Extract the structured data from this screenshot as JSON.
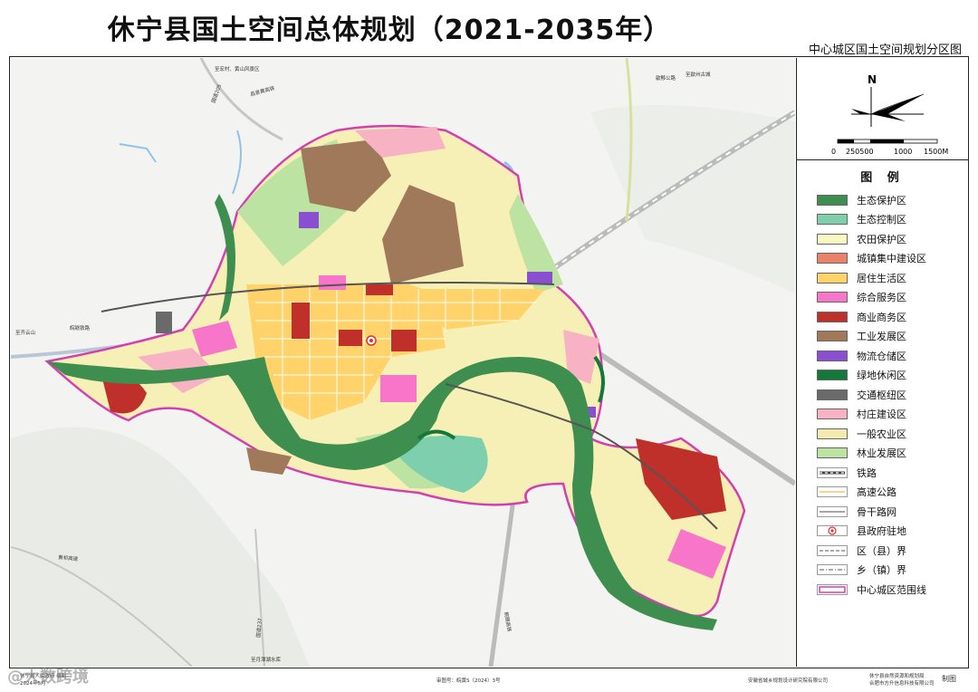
{
  "title": "休宁县国土空间总体规划（2021-2035年）",
  "subtitle": "中心城区国土空间规划分区图",
  "compass": {
    "north": "N",
    "scale_labels": [
      "0",
      "250500",
      "1000",
      "1500M"
    ]
  },
  "legend": {
    "title": "图 例",
    "items": [
      {
        "label": "生态保护区",
        "kind": "fill",
        "color": "#3e8e4f"
      },
      {
        "label": "生态控制区",
        "kind": "fill",
        "color": "#7ecfad"
      },
      {
        "label": "农田保护区",
        "kind": "fill",
        "color": "#fbf7c2"
      },
      {
        "label": "城镇集中建设区",
        "kind": "fill",
        "color": "#e8826a"
      },
      {
        "label": "居住生活区",
        "kind": "fill",
        "color": "#ffd36a"
      },
      {
        "label": "综合服务区",
        "kind": "fill",
        "color": "#f776c9"
      },
      {
        "label": "商业商务区",
        "kind": "fill",
        "color": "#c0302a"
      },
      {
        "label": "工业发展区",
        "kind": "fill",
        "color": "#a0785a"
      },
      {
        "label": "物流仓储区",
        "kind": "fill",
        "color": "#8a4fd0"
      },
      {
        "label": "绿地休闲区",
        "kind": "fill",
        "color": "#14783a"
      },
      {
        "label": "交通枢纽区",
        "kind": "fill",
        "color": "#6a6a6a"
      },
      {
        "label": "村庄建设区",
        "kind": "fill",
        "color": "#f7b3c3"
      },
      {
        "label": "一般农业区",
        "kind": "fill",
        "color": "#f1eab1"
      },
      {
        "label": "林业发展区",
        "kind": "fill",
        "color": "#bde3a2"
      },
      {
        "label": "铁路",
        "kind": "rail",
        "color": "#444444"
      },
      {
        "label": "高速公路",
        "kind": "line",
        "color": "#f2c66a"
      },
      {
        "label": "骨干路网",
        "kind": "line",
        "color": "#888888"
      },
      {
        "label": "县政府驻地",
        "kind": "dot",
        "color": "#e03030"
      },
      {
        "label": "区（县）界",
        "kind": "dash",
        "color": "#555555"
      },
      {
        "label": "乡（镇）界",
        "kind": "dashdot",
        "color": "#555555"
      },
      {
        "label": "中心城区范围线",
        "kind": "boundary",
        "color": "#d23fb0"
      }
    ]
  },
  "map_labels": {
    "top1": "至宏村、黄山风景区",
    "top2": "至歙州古城",
    "top3": "歙黟公路",
    "left": "至齐云山",
    "road1": "国道205",
    "road2": "昌景黄高铁",
    "road3": "皖赣铁路",
    "road4": "国道237",
    "bottom": "至月潭湖水库",
    "road5": "黄祁高速",
    "road6": "皖赣高铁"
  },
  "footer": {
    "left": "休宁县人民政府 编制",
    "left_date": "2024年5月",
    "center": "审图号：皖黄S（2024）3号",
    "right1": "安徽省城乡规划设计研究院有限公司",
    "right2a": "休宁县自然资源和规划局",
    "right2b": "合肥市方升信息科技有限公司",
    "made": "制图"
  },
  "watermark": "@大数跨境"
}
